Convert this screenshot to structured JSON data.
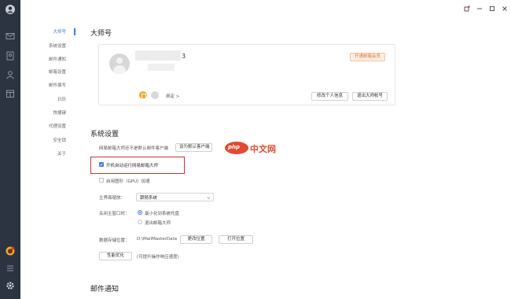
{
  "nav": {
    "items": [
      {
        "label": "大师号",
        "active": true
      },
      {
        "label": "系统设置"
      },
      {
        "label": "邮件通知"
      },
      {
        "label": "邮箱设置"
      },
      {
        "label": "邮件撰写"
      },
      {
        "label": "日历"
      },
      {
        "label": "快捷键"
      },
      {
        "label": "代理设置"
      },
      {
        "label": "安全锁"
      },
      {
        "label": "关于"
      }
    ]
  },
  "rail_icons": [
    "user-avatar-icon",
    "mail-icon",
    "contacts-icon",
    "person-icon",
    "calendar-icon",
    "app-badge-icon",
    "menu-icon",
    "gear-icon"
  ],
  "window_controls": [
    "pin-icon",
    "minimize-icon",
    "maximize-icon",
    "close-icon"
  ],
  "master": {
    "title": "大师号",
    "name_tail": "3",
    "vip_badge": "开通邮箱会员",
    "bind_link": "绑定 >",
    "edit_profile": "修改个人信息",
    "logout": "退出大师帐号"
  },
  "system": {
    "title": "系统设置",
    "default_client_text": "网易邮箱大师还不是默认邮件客户端",
    "set_default_button": "设为默认客户端",
    "autostart_label": "开机自动运行网易邮箱大师",
    "autostart_checked": true,
    "gpu_label": "启用图形（GPU）加速",
    "gpu_checked": false,
    "scale_label": "主界面缩放：",
    "scale_value": "跟随系统",
    "close_label": "关闭主窗口时：",
    "close_options": [
      {
        "label": "最小化到系统托盘",
        "selected": true
      },
      {
        "label": "退出邮箱大师",
        "selected": false
      }
    ],
    "storage_label": "数据存储位置：",
    "storage_path": "D:\\MailMasterData",
    "change_location": "更改位置",
    "open_location": "打开位置",
    "perf_button": "性能优化",
    "perf_hint": "(可提升操作响应速度)"
  },
  "mail_notify": {
    "title": "邮件通知"
  },
  "watermark": {
    "badge": "php",
    "text": "中文网"
  },
  "colors": {
    "rail": "#2b3440",
    "accent": "#3a7be0",
    "highlight_box": "#d0312d",
    "vip": "#e07a3a",
    "watermark": "#e24a31"
  }
}
